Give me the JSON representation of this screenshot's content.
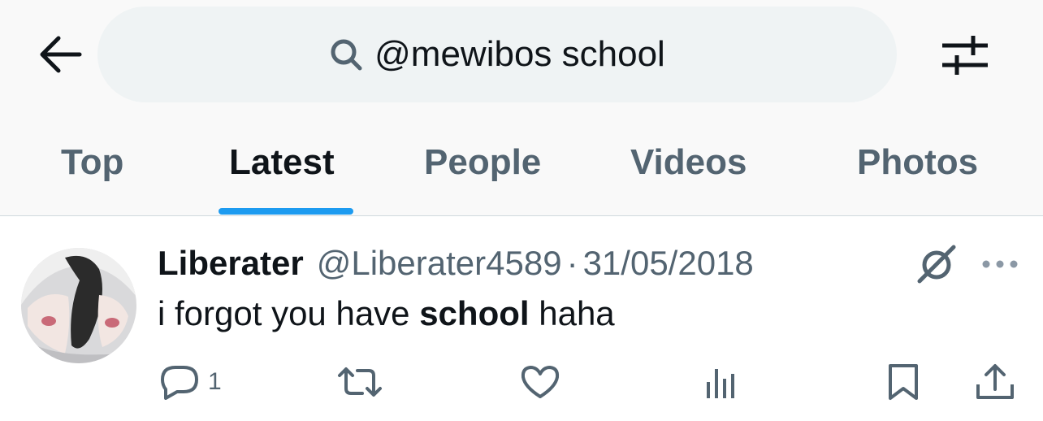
{
  "header": {
    "back_icon": "arrow-left-icon",
    "search": {
      "icon": "search-icon",
      "query": "@mewibos school"
    },
    "filter_icon": "sliders-icon"
  },
  "tabs": [
    {
      "label": "Top",
      "active": false
    },
    {
      "label": "Latest",
      "active": true
    },
    {
      "label": "People",
      "active": false
    },
    {
      "label": "Videos",
      "active": false
    },
    {
      "label": "Photos",
      "active": false
    }
  ],
  "colors": {
    "accent": "#1d9bf0",
    "secondary_text": "#536471",
    "primary_text": "#0f1419"
  },
  "tweet": {
    "display_name": "Liberater",
    "handle": "@Liberater4589",
    "separator": "·",
    "date": "31/05/2018",
    "text_before": "i forgot you have ",
    "text_highlight": "school",
    "text_after": " haha",
    "actions": {
      "reply": {
        "icon": "reply-icon",
        "count": "1"
      },
      "retweet": {
        "icon": "retweet-icon"
      },
      "like": {
        "icon": "heart-icon"
      },
      "views": {
        "icon": "views-chart-icon"
      },
      "bookmark": {
        "icon": "bookmark-icon"
      },
      "share": {
        "icon": "share-icon"
      }
    }
  }
}
